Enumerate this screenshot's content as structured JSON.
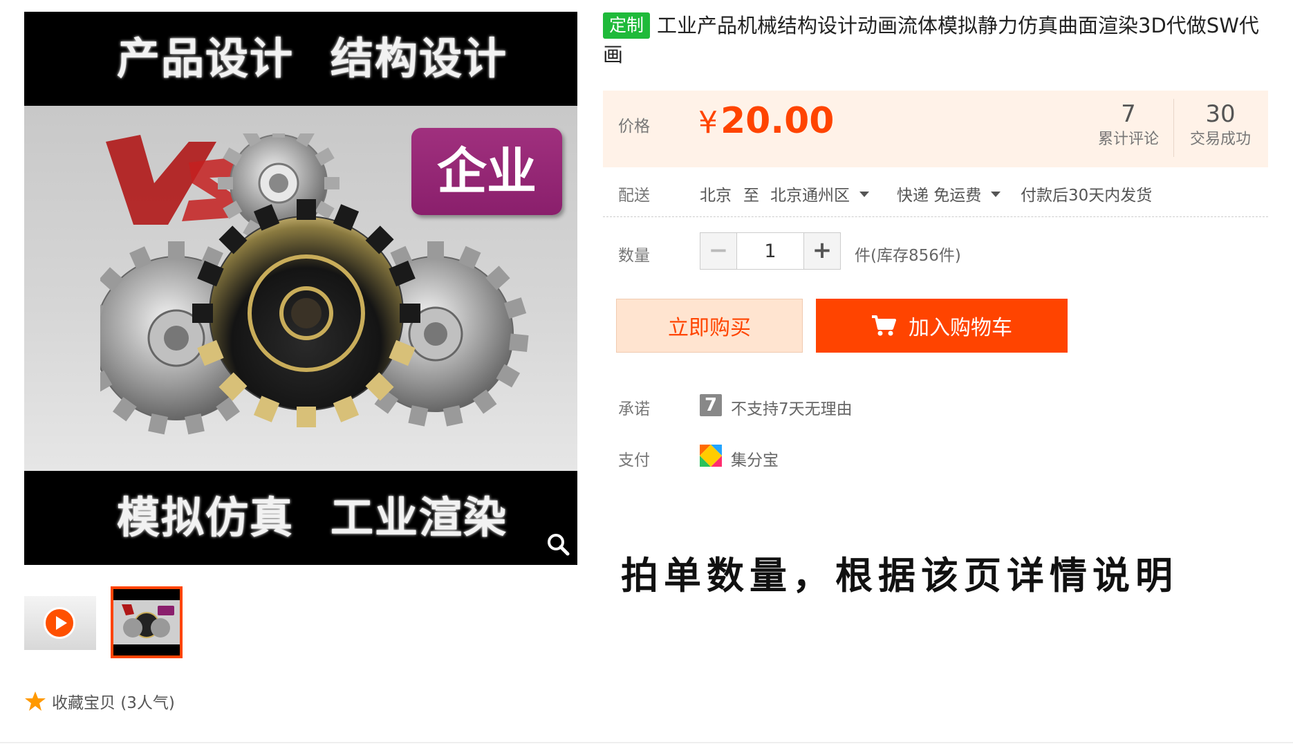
{
  "gallery": {
    "banner_top_left": "产品设计",
    "banner_top_right": "结构设计",
    "banner_bottom_left": "模拟仿真",
    "banner_bottom_right": "工业渲染",
    "badge": "企业",
    "zoom_icon": "search-icon",
    "thumb_video_icon": "play-icon"
  },
  "favorite": {
    "icon": "star-icon",
    "label": "收藏宝贝 (3人气)"
  },
  "product": {
    "tag": "定制",
    "title": "工业产品机械结构设计动画流体模拟静力仿真曲面渲染3D代做SW代画"
  },
  "price": {
    "label": "价格",
    "currency": "¥",
    "value": "20.00",
    "reviews_count": "7",
    "reviews_label": "累计评论",
    "sales_count": "30",
    "sales_label": "交易成功"
  },
  "delivery": {
    "label": "配送",
    "from": "北京",
    "to_word": "至",
    "destination": "北京通州区",
    "shipping": "快递 免运费",
    "ship_time": "付款后30天内发货"
  },
  "quantity": {
    "label": "数量",
    "minus": "−",
    "value": "1",
    "plus": "+",
    "stock": "件(库存856件)"
  },
  "actions": {
    "buy_now": "立即购买",
    "add_to_cart": "加入购物车"
  },
  "promise": {
    "label": "承诺",
    "icon_text": "7",
    "text": "不支持7天无理由"
  },
  "payment": {
    "label": "支付",
    "icon": "jifenbao-icon",
    "text": "集分宝"
  },
  "notice": "拍单数量，根据该页详情说明",
  "colors": {
    "accent": "#ff4400",
    "tag_green": "#1fba3a",
    "price_bg": "#fff2e8",
    "buy_bg": "#ffe4d0"
  }
}
